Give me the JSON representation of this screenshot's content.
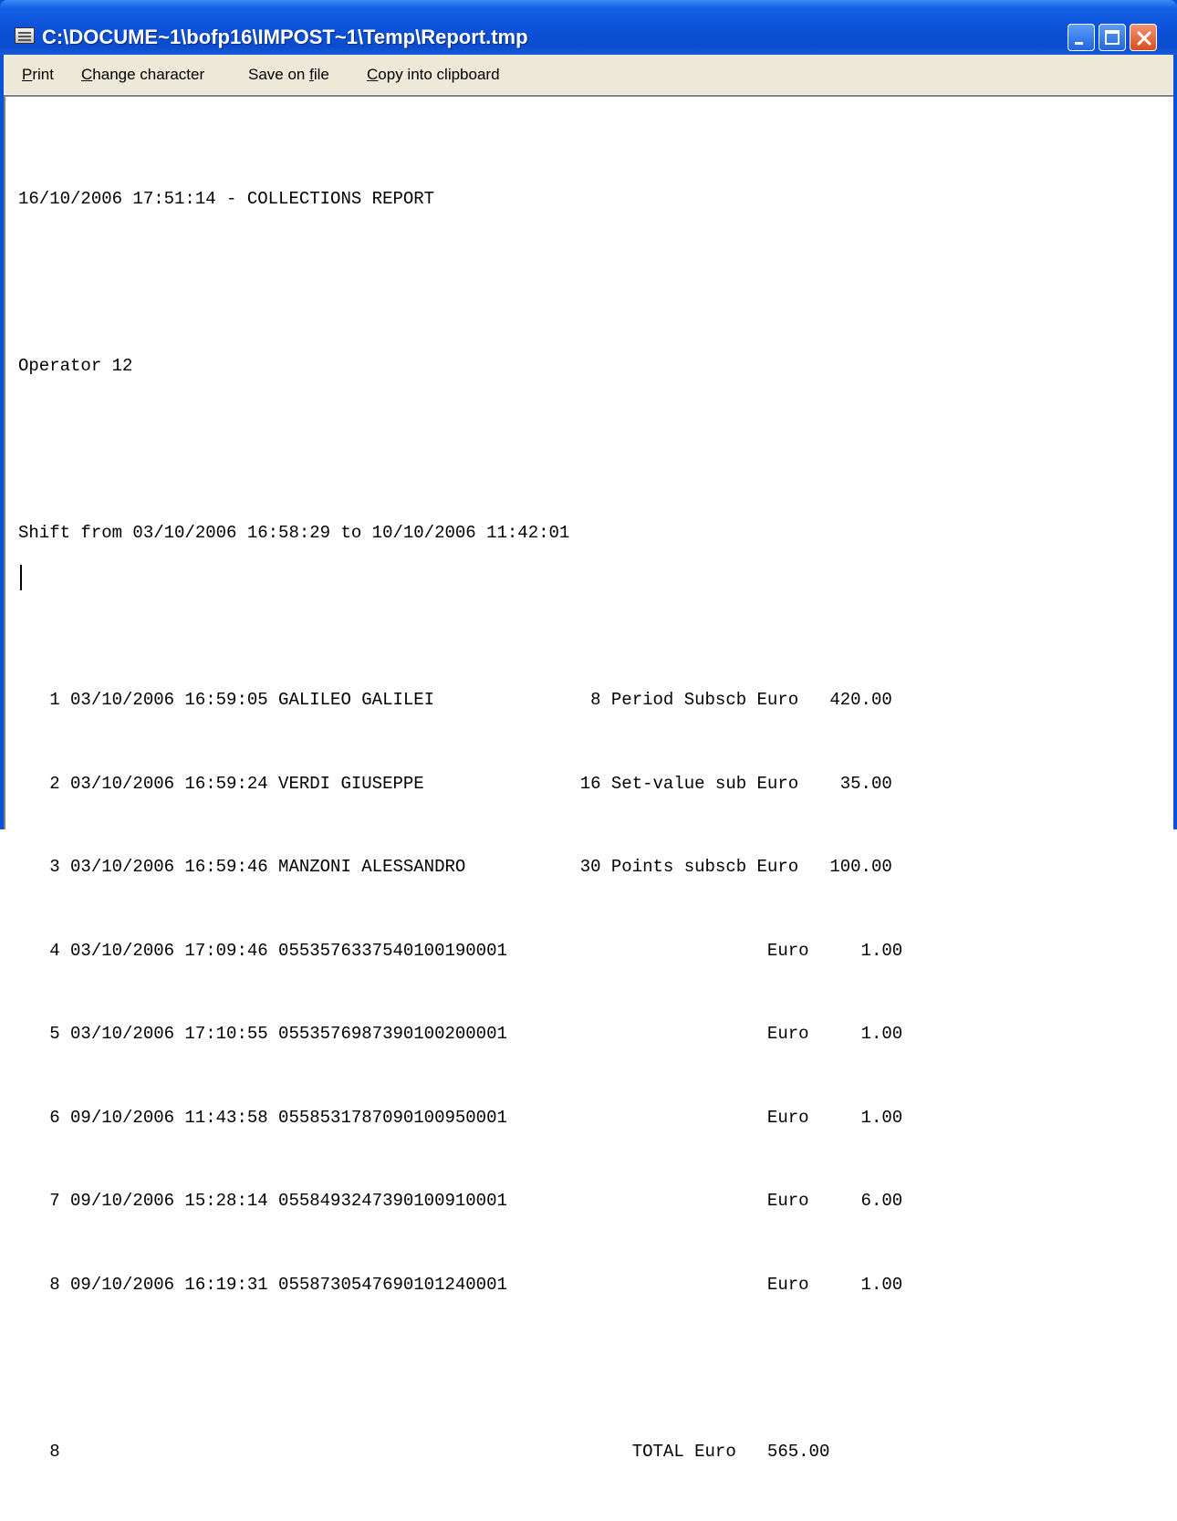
{
  "window": {
    "title": "C:\\DOCUME~1\\bofp16\\IMPOST~1\\Temp\\Report.tmp",
    "icon": "report-document-icon",
    "controls": [
      "minimize-icon",
      "maximize-icon",
      "close-icon"
    ],
    "colors": {
      "titlebar": "#0a52d8",
      "menubar": "#ece9d8",
      "close": "#d94d1c"
    }
  },
  "menu": {
    "print": {
      "accel": "P",
      "rest": "rint"
    },
    "change_character": {
      "accel": "C",
      "rest": "hange character"
    },
    "save_on_file": {
      "pre": "Save on ",
      "accel": "f",
      "post": "ile"
    },
    "copy_into_clipboard": {
      "accel": "C",
      "rest": "opy into clipboard"
    }
  },
  "report": {
    "header": "16/10/2006 17:51:14 - COLLECTIONS REPORT",
    "operator": "Operator 12",
    "shift": "Shift from 03/10/2006 16:58:29 to 10/10/2006 11:42:01",
    "rows": [
      "   1 03/10/2006 16:59:05 GALILEO GALILEI               8 Period Subscb Euro   420.00",
      "   2 03/10/2006 16:59:24 VERDI GIUSEPPE               16 Set-value sub Euro    35.00",
      "   3 03/10/2006 16:59:46 MANZONI ALESSANDRO           30 Points subscb Euro   100.00",
      "   4 03/10/2006 17:09:46 0553576337540100190001                         Euro     1.00",
      "   5 03/10/2006 17:10:55 0553576987390100200001                         Euro     1.00",
      "   6 09/10/2006 11:43:58 0558531787090100950001                         Euro     1.00",
      "   7 09/10/2006 15:28:14 0558493247390100910001                         Euro     6.00",
      "   8 09/10/2006 16:19:31 0558730547690101240001                         Euro     1.00"
    ],
    "total": "   8                                                       TOTAL Euro   565.00"
  }
}
